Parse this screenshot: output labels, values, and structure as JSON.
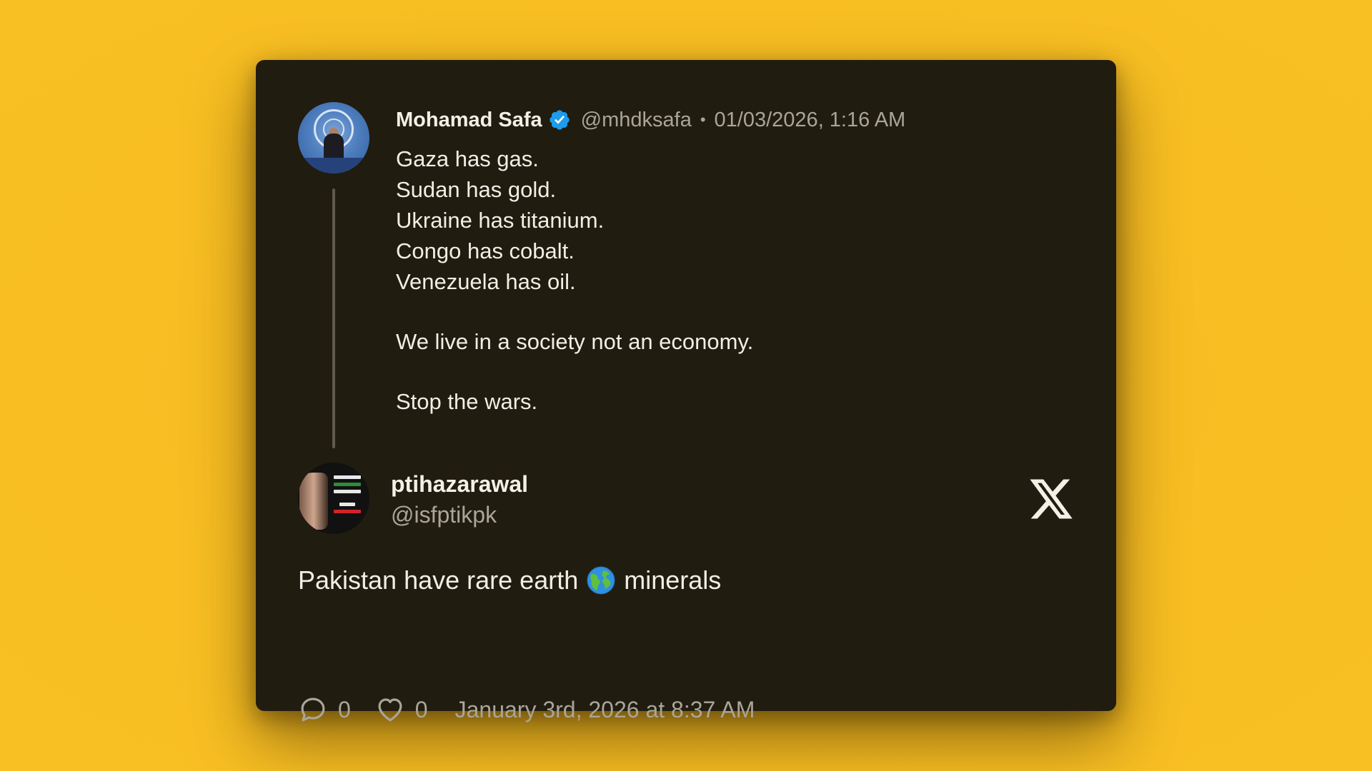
{
  "quoted_tweet": {
    "author_name": "Mohamad Safa",
    "handle": "@mhdksafa",
    "separator": "•",
    "date": "01/03/2026, 1:16 AM",
    "lines": [
      "Gaza has gas.",
      "Sudan has gold.",
      "Ukraine has titanium.",
      "Congo has cobalt.",
      "Venezuela has oil.",
      "We live in a society not an economy.",
      "Stop the wars."
    ]
  },
  "reply": {
    "author_name": "ptihazarawal",
    "handle": "@isfptikpk",
    "text_before": "Pakistan have rare earth",
    "text_after": "minerals",
    "replies_count": "0",
    "likes_count": "0",
    "timestamp": "January 3rd, 2026 at 8:37 AM"
  },
  "colors": {
    "background": "#f8bd22",
    "card": "#211c10",
    "text": "#f1eee6",
    "muted": "#aaa59a",
    "verified": "#1d9bf0"
  },
  "icons": {
    "verified": "verified-badge-icon",
    "brand": "x-logo-icon",
    "globe": "globe-emoji-icon",
    "reply": "comment-bubble-icon",
    "like": "heart-icon"
  }
}
